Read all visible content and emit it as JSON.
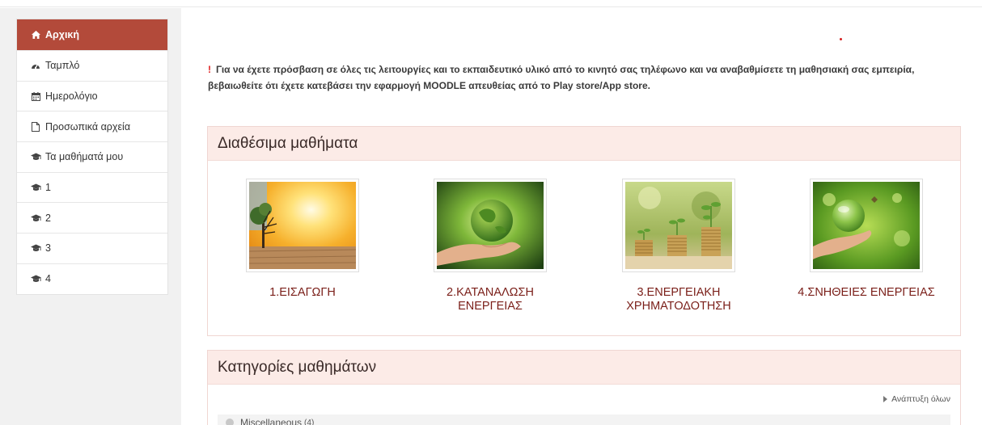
{
  "sidebar": {
    "items": [
      {
        "label": "Αρχική",
        "icon": "home-icon",
        "active": true
      },
      {
        "label": "Ταμπλό",
        "icon": "dashboard-icon",
        "active": false
      },
      {
        "label": "Ημερολόγιο",
        "icon": "calendar-icon",
        "active": false
      },
      {
        "label": "Προσωπικά αρχεία",
        "icon": "file-icon",
        "active": false
      },
      {
        "label": "Τα μαθήματά μου",
        "icon": "graduation-cap-icon",
        "active": false
      },
      {
        "label": "1",
        "icon": "graduation-cap-icon",
        "active": false
      },
      {
        "label": "2",
        "icon": "graduation-cap-icon",
        "active": false
      },
      {
        "label": "3",
        "icon": "graduation-cap-icon",
        "active": false
      },
      {
        "label": "4",
        "icon": "graduation-cap-icon",
        "active": false
      }
    ]
  },
  "notice": {
    "mark": "!",
    "text": "Για να έχετε πρόσβαση σε όλες τις λειτουργίες και το εκπαιδευτικό υλικό από το κινητό σας τηλέφωνο και να αναβαθμίσετε τη μαθησιακή σας εμπειρία, βεβαιωθείτε ότι έχετε κατεβάσει την εφαρμογή MOODLE απευθείας από το Play store/App store."
  },
  "available_courses": {
    "heading": "Διαθέσιμα μαθήματα",
    "courses": [
      {
        "line1": "1.ΕΙΣΑΓΩΓΗ",
        "line2": ""
      },
      {
        "line1": "2.ΚΑΤΑΝΑΛΩΣΗ",
        "line2": "ΕΝΕΡΓΕΙΑΣ"
      },
      {
        "line1": "3.ΕΝΕΡΓΕΙΑΚΗ",
        "line2": "ΧΡΗΜΑΤΟΔΟΤΗΣΗ"
      },
      {
        "line1": "4.ΣΝΗΘΕΙΕΣ ΕΝΕΡΓΕΙΑΣ",
        "line2": ""
      }
    ]
  },
  "categories": {
    "heading": "Κατηγορίες μαθημάτων",
    "expand_all": "Ανάπτυξη όλων",
    "items": [
      {
        "name": "Miscellaneous",
        "count": "(4)"
      }
    ]
  },
  "colors": {
    "accent": "#b34a3a",
    "panel_header_bg": "#fcebe7",
    "course_title": "#7a1e18",
    "notice_mark": "#e02020"
  }
}
